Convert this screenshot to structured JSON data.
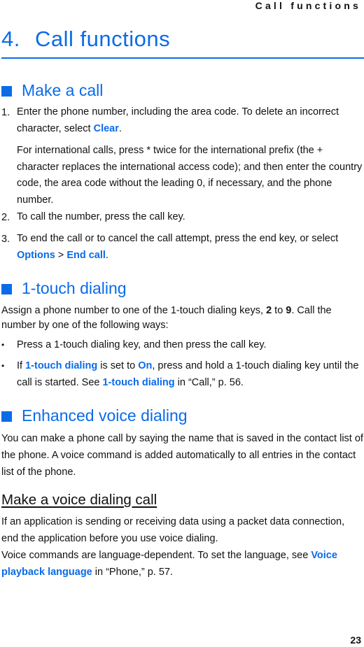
{
  "running_header": "Call functions",
  "chapter": {
    "number": "4.",
    "title": "Call functions"
  },
  "sections": {
    "make_call": {
      "heading": "Make a call",
      "step1": {
        "marker": "1.",
        "text_a": "Enter the phone number, including the area code. To delete an incorrect character, select ",
        "link_clear": "Clear",
        "text_b": ".",
        "para2": "For international calls, press * twice for the international prefix (the + character replaces the international access code); and then enter the country code, the area code without the leading 0, if necessary, and the phone number."
      },
      "step2": {
        "marker": "2.",
        "text": "To call the number, press the call key."
      },
      "step3": {
        "marker": "3.",
        "text_a": "To end the call or to cancel the call attempt, press the end key, or select ",
        "link_options": "Options",
        "sep": " > ",
        "link_end_call": "End call",
        "text_b": "."
      }
    },
    "one_touch": {
      "heading": "1-touch dialing",
      "intro_a": "Assign a phone number to one of the 1-touch dialing keys, ",
      "key_from": "2",
      "intro_b": " to ",
      "key_to": "9",
      "intro_c": ". Call the number by one of the following ways:",
      "bullet_marker": "•",
      "bullet1": "Press a 1-touch dialing key, and then press the call key.",
      "bullet2": {
        "text_a": "If ",
        "link1": "1-touch dialing",
        "text_b": " is set to ",
        "link_on": "On",
        "text_c": ", press and hold a 1-touch dialing key until the call is started. See ",
        "link2": "1-touch dialing",
        "text_d": " in “Call,” p. 56."
      }
    },
    "enhanced_voice": {
      "heading": "Enhanced voice dialing",
      "para": "You can make a phone call by saying the name that is saved in the contact list of the phone. A voice command is added automatically to all entries in the contact list of the phone."
    },
    "voice_call": {
      "heading": "Make a voice dialing call",
      "para1": "If an application is sending or receiving data using a packet data connection, end the application before you use voice dialing.",
      "para2_a": "Voice commands are language-dependent. To set the language, see ",
      "link_voice": "Voice playback language",
      "para2_b": " in “Phone,” p. 57."
    }
  },
  "page_number": "23",
  "colors": {
    "accent": "#0a6be8",
    "text": "#111111"
  }
}
